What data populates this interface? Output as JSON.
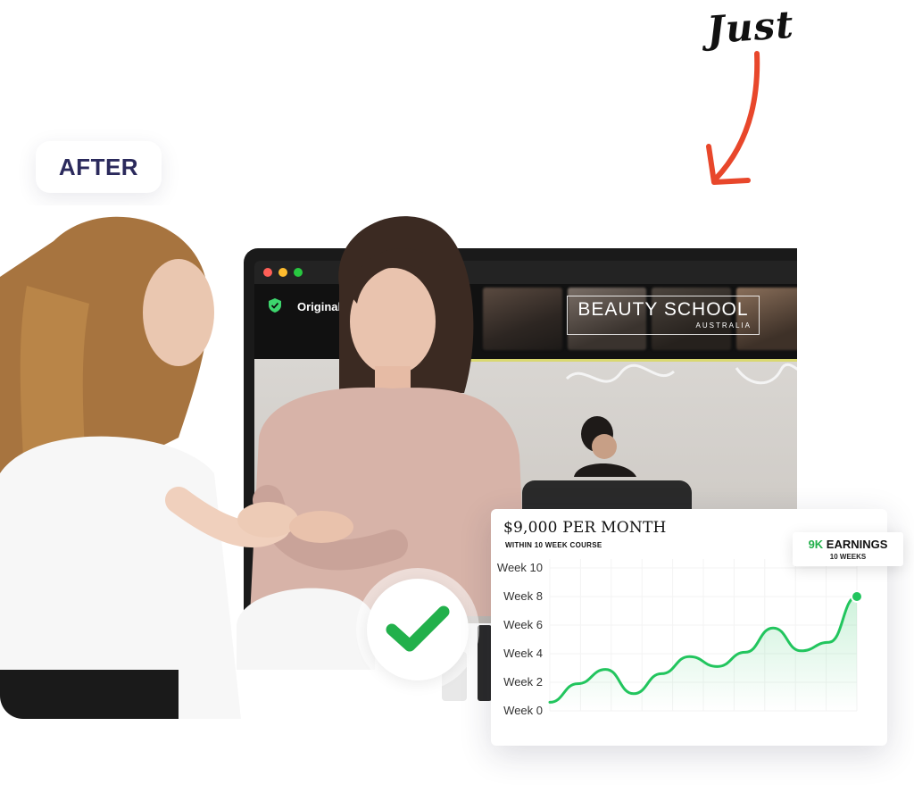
{
  "annotation": {
    "handwritten_text": "Just",
    "arrow_color": "#e8472b"
  },
  "badge": {
    "label": "AFTER",
    "color": "#2b2a5c"
  },
  "video_call": {
    "verified_label": "Original",
    "brand_name": "BEAUTY SCHOOL",
    "brand_subtitle": "AUSTRALIA",
    "window_controls": [
      "close",
      "minimize",
      "maximize"
    ],
    "icons": [
      "shield-check-icon"
    ]
  },
  "status_icon": "checkmark-icon",
  "status_color": "#22b04b",
  "earnings_card": {
    "title": "$9,000 PER MONTH",
    "subtitle": "WITHIN 10 WEEK COURSE",
    "callout_accent": "9K",
    "callout_rest": " EARNINGS",
    "callout_sub": "10 WEEKS"
  },
  "chart_data": {
    "type": "line",
    "title": "$9,000 PER MONTH",
    "subtitle": "WITHIN 10 WEEK COURSE",
    "y_ticks": [
      "Week 0",
      "Week 2",
      "Week 4",
      "Week 6",
      "Week 8",
      "Week 10"
    ],
    "ylim": [
      0,
      10
    ],
    "x": [
      0,
      1,
      2,
      3,
      4,
      5,
      6,
      7,
      8,
      9,
      10
    ],
    "series": [
      {
        "values": [
          0.6,
          1.9,
          2.9,
          1.2,
          2.6,
          3.8,
          3.1,
          4.1,
          5.8,
          4.2,
          4.8,
          8.0
        ],
        "color": "#22c55e"
      }
    ],
    "grid": true
  }
}
